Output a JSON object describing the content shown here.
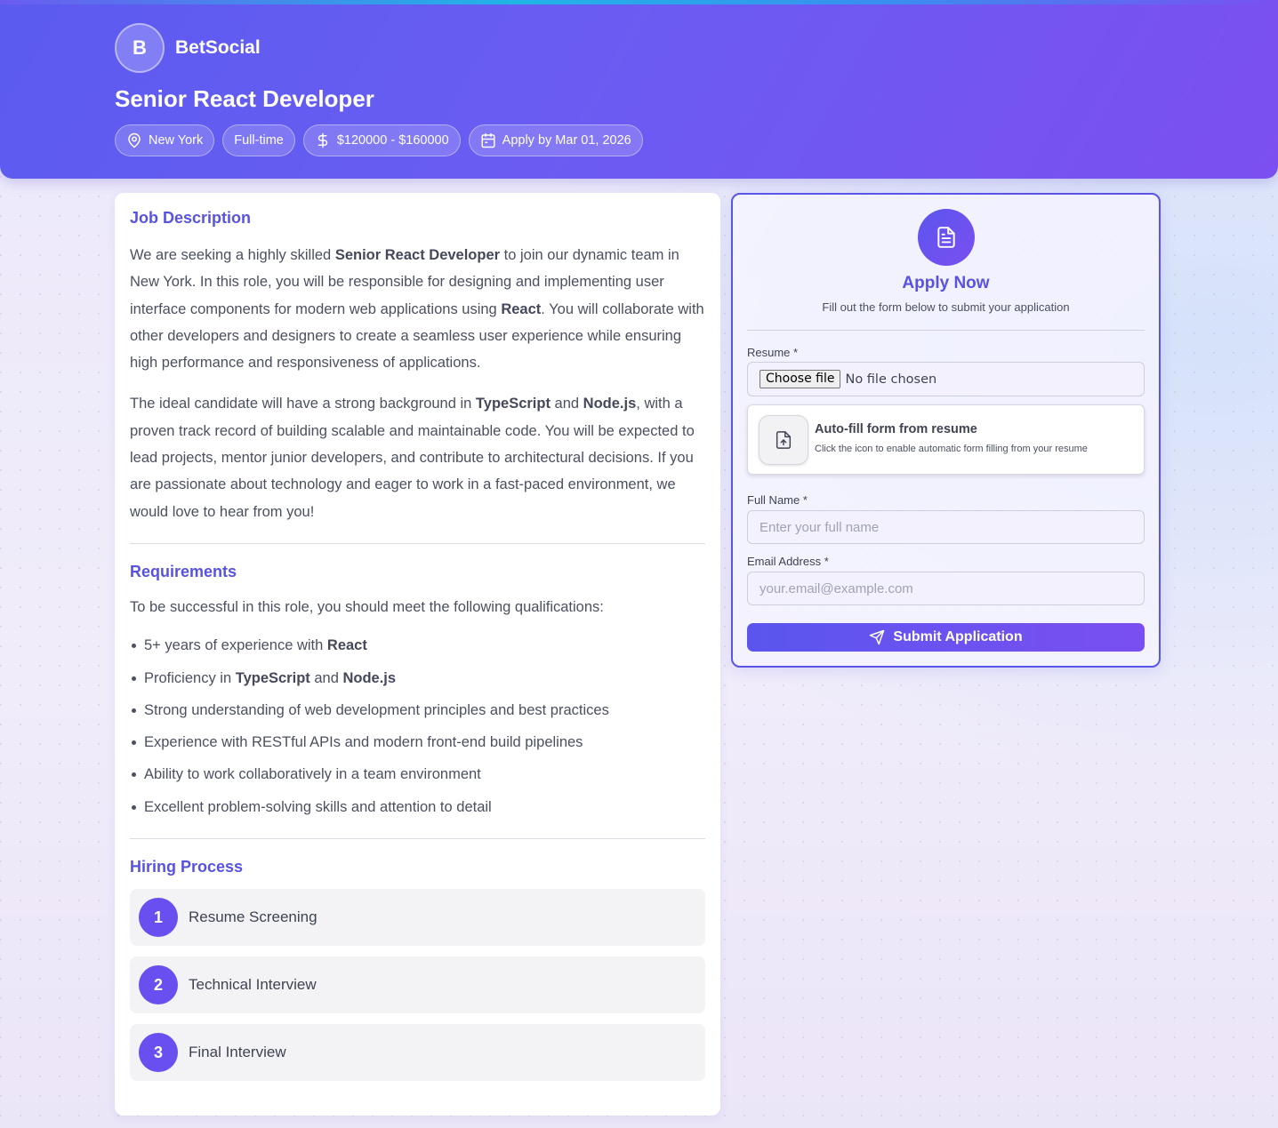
{
  "header": {
    "brand_initial": "B",
    "brand_name": "BetSocial",
    "job_title": "Senior React Developer",
    "chips": {
      "location": "New York",
      "type": "Full-time",
      "salary": "$120000 - $160000",
      "deadline": "Apply by Mar 01, 2026"
    }
  },
  "description": {
    "title": "Job Description",
    "p1": {
      "t1": "We are seeking a highly skilled ",
      "b1": "Senior React Developer",
      "t2": " to join our dynamic team in New York. In this role, you will be responsible for designing and implementing user interface components for modern web applications using ",
      "b2": "React",
      "t3": ". You will collaborate with other developers and designers to create a seamless user experience while ensuring high performance and responsiveness of applications."
    },
    "p2": {
      "t1": "The ideal candidate will have a strong background in ",
      "b1": "TypeScript",
      "t2": " and ",
      "b2": "Node.js",
      "t3": ", with a proven track record of building scalable and maintainable code. You will be expected to lead projects, mentor junior developers, and contribute to architectural decisions. If you are passionate about technology and eager to work in a fast-paced environment, we would love to hear from you!"
    }
  },
  "requirements": {
    "title": "Requirements",
    "intro": "To be successful in this role, you should meet the following qualifications:",
    "item1": {
      "t1": "5+ years of experience with ",
      "b1": "React"
    },
    "item2": {
      "t1": "Proficiency in ",
      "b1": "TypeScript",
      "t2": " and ",
      "b2": "Node.js"
    },
    "item3": "Strong understanding of web development principles and best practices",
    "item4": "Experience with RESTful APIs and modern front-end build pipelines",
    "item5": "Ability to work collaboratively in a team environment",
    "item6": "Excellent problem-solving skills and attention to detail"
  },
  "hiring": {
    "title": "Hiring Process",
    "steps": [
      {
        "num": "1",
        "label": "Resume Screening"
      },
      {
        "num": "2",
        "label": "Technical Interview"
      },
      {
        "num": "3",
        "label": "Final Interview"
      }
    ]
  },
  "apply": {
    "title": "Apply Now",
    "subtitle": "Fill out the form below to submit your application",
    "resume_label": "Resume",
    "required_mark": "*",
    "file_button": "Choose file",
    "file_status": "No file chosen",
    "autofill_title": "Auto-fill form from resume",
    "autofill_sub": "Click the icon to enable automatic form filling from your resume",
    "name_label": "Full Name",
    "name_placeholder": "Enter your full name",
    "email_label": "Email Address",
    "email_placeholder": "your.email@example.com",
    "submit": "Submit Application"
  },
  "colors": {
    "accent": "#5753e0",
    "header_gradient_start": "#5b5bf0",
    "header_gradient_end": "#7c4ff1",
    "step_badge": "#6a4ff0"
  },
  "icons": {
    "location": "map-pin-icon",
    "salary": "dollar-icon",
    "deadline": "calendar-icon",
    "apply": "document-icon",
    "autofill": "file-upload-icon",
    "submit": "send-icon"
  }
}
